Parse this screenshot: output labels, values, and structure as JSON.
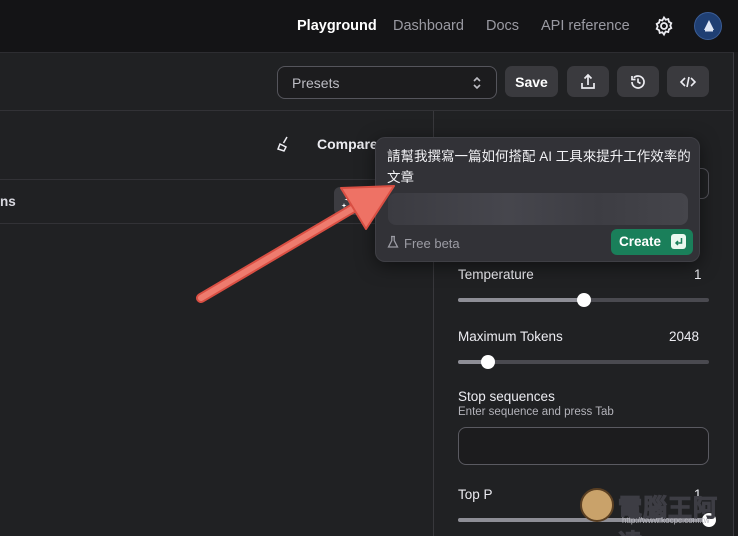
{
  "nav": {
    "items": [
      {
        "label": "Playground",
        "active": true
      },
      {
        "label": "Dashboard",
        "active": false
      },
      {
        "label": "Docs",
        "active": false
      },
      {
        "label": "API reference",
        "active": false
      }
    ],
    "icons": [
      "gear-icon",
      "avatar"
    ]
  },
  "toolbar": {
    "presets_label": "Presets",
    "save_label": "Save",
    "icons": [
      "share-icon",
      "history-icon",
      "code-icon"
    ]
  },
  "editor": {
    "compare_label": "Compare",
    "instructions_fragment": "ns"
  },
  "popover": {
    "prompt_text": "請幫我撰寫一篇如何搭配 AI 工具來提升工作效率的文章",
    "beta_label": "Free beta",
    "create_label": "Create"
  },
  "settings": {
    "temperature": {
      "label": "Temperature",
      "value": "1",
      "fraction": 0.5
    },
    "max_tokens": {
      "label": "Maximum Tokens",
      "value": "2048",
      "fraction": 0.12
    },
    "stop_sequences": {
      "label": "Stop sequences",
      "hint": "Enter sequence and press Tab"
    },
    "top_p": {
      "label": "Top P",
      "value": "1",
      "fraction": 1.0
    }
  },
  "watermark": {
    "text": "電腦王阿達",
    "url": "http://www.kocpc.com.tw"
  },
  "colors": {
    "accent_green": "#1a7f5a",
    "annotation_arrow": "#e8675a",
    "background": "#202123"
  }
}
